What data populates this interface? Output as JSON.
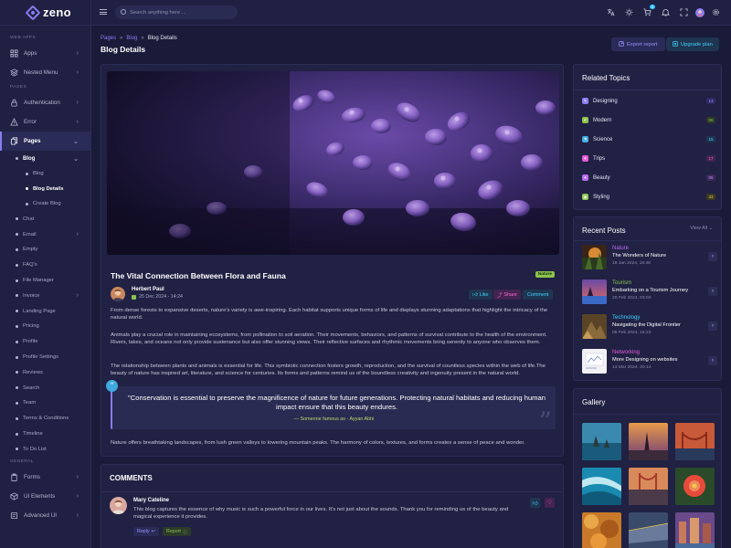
{
  "brand": {
    "name": "zeno"
  },
  "sidebar": {
    "sections": {
      "web_apps": "WEB APPS",
      "pages": "PAGES",
      "general": "GENERAL"
    },
    "apps": "Apps",
    "nested_menu": "Nested Menu",
    "authentication": "Authentication",
    "error": "Error",
    "pages": "Pages",
    "blog": "Blog",
    "blog_children": [
      "Blog",
      "Blog Details",
      "Create Blog"
    ],
    "page_items": [
      "Chat",
      "Email",
      "Empty",
      "FAQ's",
      "File Manager",
      "Invoice",
      "Landing Page",
      "Pricing",
      "Profile",
      "Profile Settings",
      "Reviews",
      "Search",
      "Team",
      "Terms & Conditions",
      "Timeline",
      "To Do List"
    ],
    "general_items": [
      "Forms",
      "UI Elements",
      "Advanced UI"
    ]
  },
  "topbar": {
    "search_placeholder": "Search anything here ...",
    "cart_count": "5"
  },
  "breadcrumb": {
    "items": [
      "Pages",
      "Blog",
      "Blog Details"
    ],
    "sep": "»"
  },
  "page": {
    "title": "Blog Details",
    "export_label": "Export report",
    "upgrade_label": "Upgrade plan"
  },
  "post": {
    "title": "The Vital Connection Between Flora and Fauna",
    "badge": "Nature",
    "author": "Herbert Paul",
    "date": "25 Dec 2024 - 14:24",
    "like": "Like",
    "share": "Share",
    "comment": "Comment",
    "p1": "From dense forests to expansive deserts, nature's variety is awe-inspiring. Each habitat supports unique forms of life and displays stunning adaptations that highlight the intricacy of the natural world.",
    "p2": "Animals play a crucial role in maintaining ecosystems, from pollination to soil aeration. Their movements, behaviors, and patterns of survival contribute to the health of the environment. Rivers, lakes, and oceans not only provide sustenance but also offer stunning views. Their reflective surfaces and rhythmic movements bring serenity to anyone who observes them.",
    "p3": "The relationship between plants and animals is essential for life. This symbiotic connection fosters growth, reproduction, and the survival of countless species within the web of life.The beauty of nature has inspired art, literature, and science for centuries. Its forms and patterns remind us of the boundless creativity and ingenuity present in the natural world.",
    "quote": "\"Conservation is essential to preserve the magnificence of nature for future generations. Protecting natural habitats and reducing human impact ensure that this beauty endures.",
    "quote_by": "— Someone famous as - Ayyan Abhi",
    "p4": "Nature offers breathtaking landscapes, from lush green valleys to towering mountain peaks. The harmony of colors, textures, and forms creates a sense of peace and wonder."
  },
  "comments": {
    "title": "COMMENTS",
    "items": [
      {
        "name": "Mary Cateline",
        "text": "This blog captures the essence of why music is such a powerful force in our lives. It's not just about the sounds. Thank you for reminding us of the beauty and magical experience it provides.",
        "reply": "Reply",
        "report": "Report"
      }
    ]
  },
  "related_topics": {
    "title": "Related Topics",
    "items": [
      {
        "label": "Designing",
        "count": "13",
        "color": "#8a7cf0",
        "count_bg": "#2e2c66",
        "count_color": "#9c91ff"
      },
      {
        "label": "Modern",
        "count": "06",
        "color": "#8bc34a",
        "count_bg": "#2c3a2a",
        "count_color": "#8bc34a"
      },
      {
        "label": "Science",
        "count": "15",
        "color": "#3fa9e0",
        "count_bg": "#1f3550",
        "count_color": "#3fd3ff"
      },
      {
        "label": "Trips",
        "count": "17",
        "color": "#e55ad8",
        "count_bg": "#43254f",
        "count_color": "#ff6ad8"
      },
      {
        "label": "Beauty",
        "count": "05",
        "color": "#b56cf0",
        "count_bg": "#3a2a5a",
        "count_color": "#c98aff"
      },
      {
        "label": "Styling",
        "count": "33",
        "color": "#8bc34a",
        "count_bg": "#3a3a22",
        "count_color": "#e5c65a"
      }
    ]
  },
  "recent_posts": {
    "title": "Recent Posts",
    "view_all": "View All",
    "items": [
      {
        "category": "Nature",
        "title": "The Wonders of Nature",
        "date": "18 Jan 2024, 15:48",
        "color": "#b56cf0"
      },
      {
        "category": "Tourism",
        "title": "Embarking on a Tourism Journey",
        "date": "20 Feb 2024, 03:03",
        "color": "#8bc34a"
      },
      {
        "category": "Technology",
        "title": "Navigating the Digital Frontier",
        "date": "05 Feb 2024, 16:23",
        "color": "#3fd3ff"
      },
      {
        "category": "Networking",
        "title": "More Designing on websites",
        "date": "13 Mar 2024, 20:14",
        "color": "#e55ad8"
      }
    ]
  },
  "gallery": {
    "title": "Gallery"
  }
}
